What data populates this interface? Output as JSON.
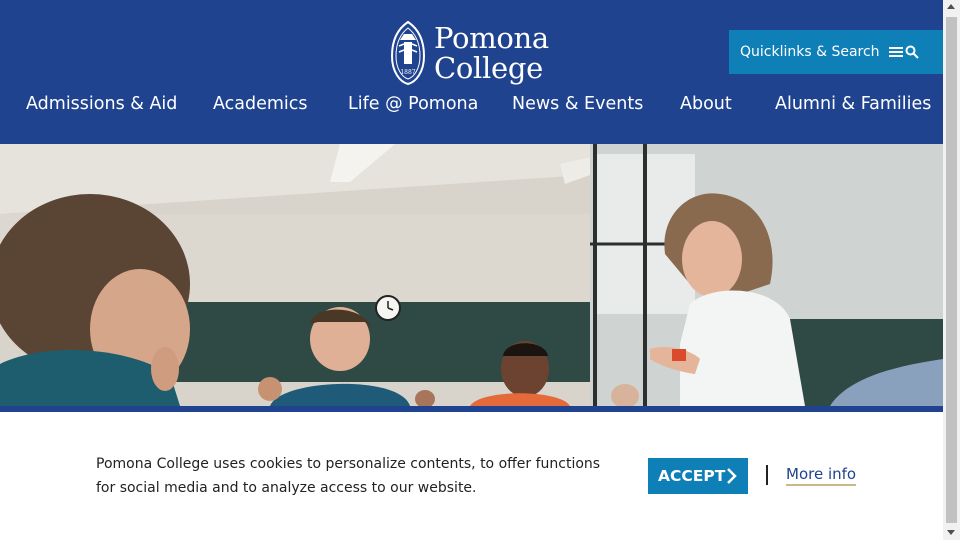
{
  "header": {
    "logo": {
      "line1": "Pomona",
      "line2": "College",
      "seal_year": "1887"
    },
    "quicklinks_label": "Quicklinks & Search",
    "quicklinks_icons": [
      "menu-icon",
      "search-icon"
    ]
  },
  "nav": {
    "items": [
      {
        "label": "Admissions & Aid"
      },
      {
        "label": "Academics"
      },
      {
        "label": "Life @ Pomona"
      },
      {
        "label": "News & Events"
      },
      {
        "label": "About"
      },
      {
        "label": "Alumni & Families"
      }
    ]
  },
  "hero": {
    "description_icon": "classroom-photo"
  },
  "cookie": {
    "text": "Pomona College uses cookies to personalize contents, to offer functions for social media and to analyze access to our website.",
    "accept_label": "ACCEPT",
    "more_info_label": "More info"
  },
  "colors": {
    "brand_blue": "#20438f",
    "accent_blue": "#0f7fb8",
    "link_underline": "#c8b98a"
  }
}
